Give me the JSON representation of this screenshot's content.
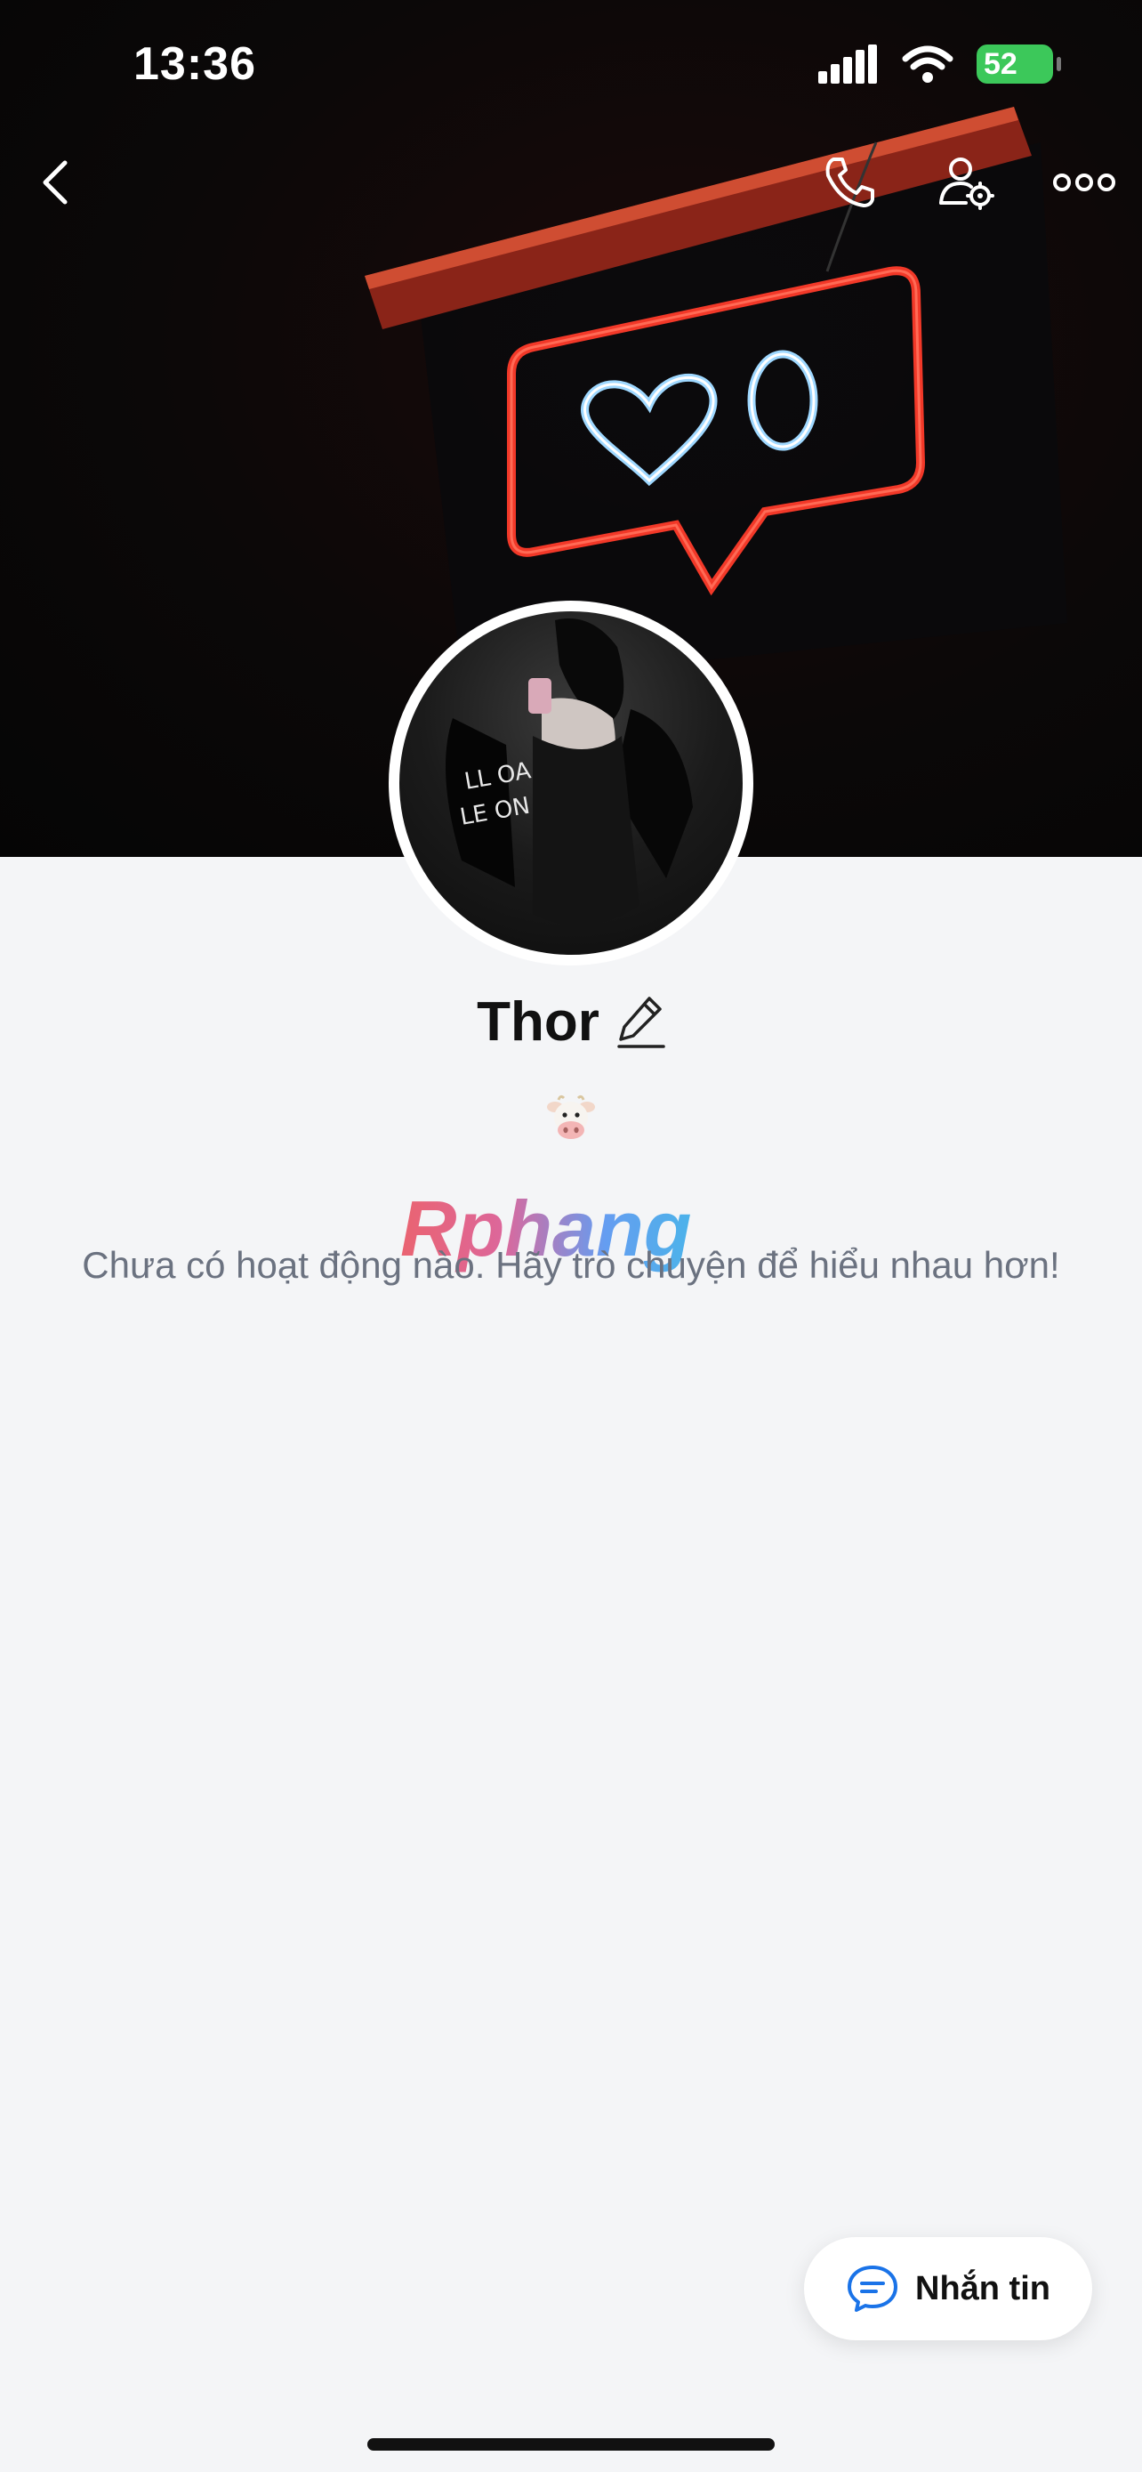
{
  "status_bar": {
    "time": "13:36",
    "battery": "52"
  },
  "header": {
    "back_icon": "chevron-left-icon",
    "call_icon": "phone-icon",
    "profile_settings_icon": "user-gear-icon",
    "more_icon": "ellipsis-icon"
  },
  "profile": {
    "name": "Thor",
    "edit_icon": "pencil-icon",
    "bio_emoji": "cow-face-emoji"
  },
  "feed": {
    "empty_message": "Chưa có hoạt động nào. Hãy trò chuyện để hiểu nhau hơn!"
  },
  "watermark": "Rphang",
  "fab": {
    "label": "Nhắn tin",
    "icon": "chat-bubble-icon"
  },
  "colors": {
    "accent": "#1a73e8",
    "battery": "#3cc85a",
    "background": "#f4f5f7"
  }
}
